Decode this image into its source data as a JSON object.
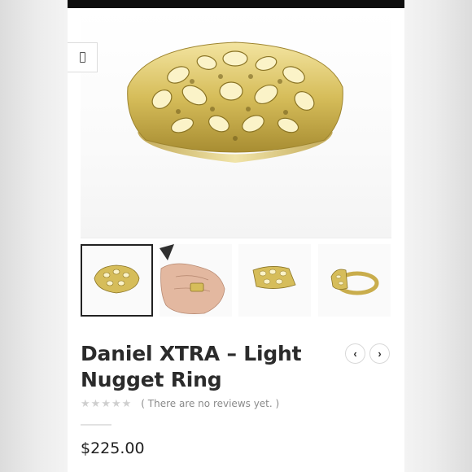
{
  "product": {
    "title": "Daniel XTRA – Light Nugget Ring",
    "price": "$225.00",
    "rating": {
      "stars": 0,
      "max": 5,
      "reviews_text": "( There are no reviews yet. )"
    }
  },
  "gallery": {
    "active_index": 0,
    "thumbnails": [
      "ring-front",
      "ring-on-hand",
      "ring-angle",
      "ring-side"
    ]
  },
  "icons": {
    "zoom": "zoom-icon",
    "prev": "‹",
    "next": "›"
  },
  "colors": {
    "gold": "#d9c36a",
    "gold_dark": "#8a7425",
    "gold_light": "#f5e9a8",
    "topbar": "#0d0d0d"
  }
}
